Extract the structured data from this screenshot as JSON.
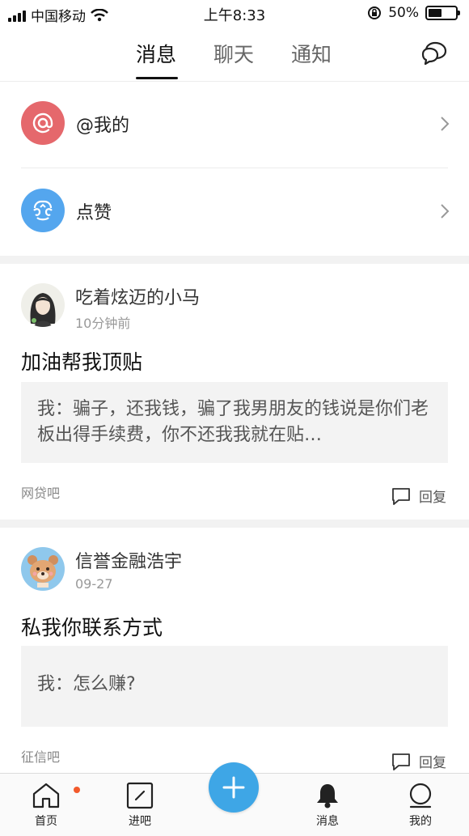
{
  "status": {
    "carrier": "中国移动",
    "time": "上午8:33",
    "battery": "50%"
  },
  "tabs": [
    {
      "label": "消息",
      "active": true
    },
    {
      "label": "聊天",
      "active": false
    },
    {
      "label": "通知",
      "active": false
    }
  ],
  "shortcuts": [
    {
      "label": "@我的",
      "icon": "at-icon",
      "color": "#e5686c"
    },
    {
      "label": "点赞",
      "icon": "thumbs-up-icon",
      "color": "#54a6ee"
    }
  ],
  "posts": [
    {
      "author": "吃着炫迈的小马",
      "time": "10分钟前",
      "title": "加油帮我顶贴",
      "quote": "我：骗子，还我钱，骗了我男朋友的钱说是你们老板出得手续费，你不还我我就在贴…",
      "forum": "网贷吧",
      "reply_label": "回复"
    },
    {
      "author": "信誉金融浩宇",
      "time": "09-27",
      "title": "私我你联系方式",
      "quote": "我：怎么赚?",
      "forum": "征信吧",
      "reply_label": "回复"
    }
  ],
  "bottom_nav": [
    {
      "label": "首页",
      "icon": "home-icon",
      "badge": true
    },
    {
      "label": "进吧",
      "icon": "enter-bar-icon"
    },
    {
      "label": "",
      "icon": "plus-icon"
    },
    {
      "label": "消息",
      "icon": "bell-icon"
    },
    {
      "label": "我的",
      "icon": "profile-icon"
    }
  ],
  "colors": {
    "accent": "#3ea6e6",
    "badge": "#f25a2c"
  }
}
